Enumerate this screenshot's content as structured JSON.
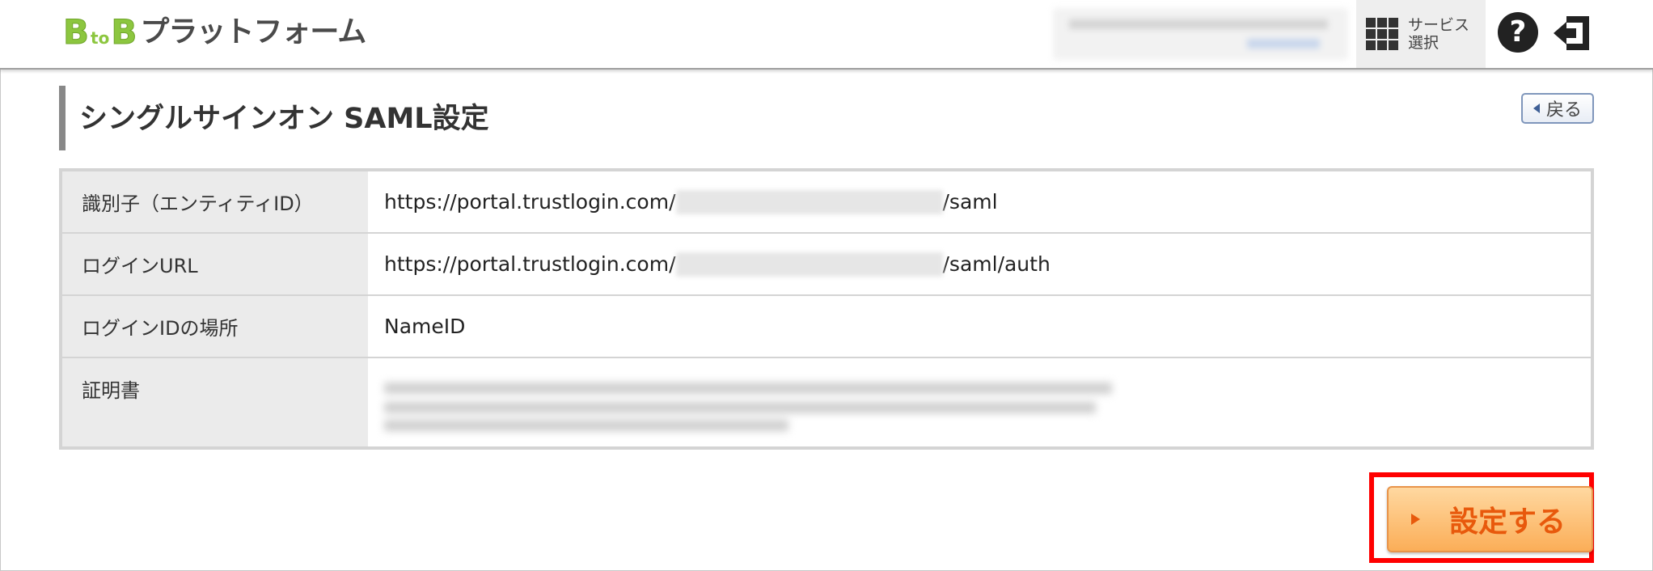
{
  "header": {
    "logo": {
      "b1": "B",
      "to": "to",
      "b2": "B",
      "name": "プラットフォーム"
    },
    "service_select_label": "サービス選択",
    "help_icon": "question-circle-icon",
    "logout_icon": "logout-arrow-icon",
    "grid_icon": "grid-icon"
  },
  "page": {
    "title": "シングルサインオン SAML設定",
    "back_label": "戻る"
  },
  "table": {
    "rows": [
      {
        "label": "識別子（エンティティID）",
        "prefix": "https://portal.trustlogin.com/",
        "suffix": "/saml"
      },
      {
        "label": "ログインURL",
        "prefix": "https://portal.trustlogin.com/",
        "suffix": "/saml/auth"
      },
      {
        "label": "ログインIDの場所",
        "value": "NameID"
      },
      {
        "label": "証明書"
      }
    ]
  },
  "actions": {
    "submit_label": "設定する"
  },
  "colors": {
    "logo_green": "#8cc63f",
    "submit_text": "#e8590c",
    "highlight": "#ff0000"
  }
}
